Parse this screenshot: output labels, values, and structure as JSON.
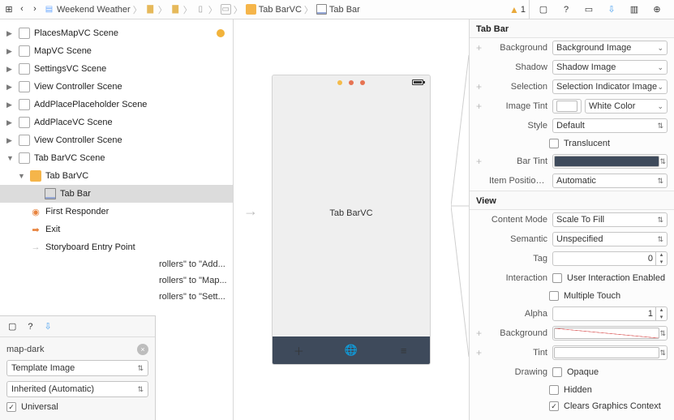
{
  "breadcrumb": {
    "project": "Weekend Weather",
    "tabvc": "Tab BarVC",
    "tabbar": "Tab Bar",
    "warning_count": "1"
  },
  "outline": {
    "scenes": [
      "PlacesMapVC Scene",
      "MapVC Scene",
      "SettingsVC Scene",
      "View Controller Scene",
      "AddPlacePlaceholder Scene",
      "AddPlaceVC Scene",
      "View Controller Scene",
      "Tab BarVC Scene"
    ],
    "tabvc_item": "Tab BarVC",
    "tabbar_item": "Tab Bar",
    "first_responder": "First Responder",
    "exit": "Exit",
    "entry": "Storyboard Entry Point",
    "refs": [
      "rollers\" to \"Add...",
      "rollers\" to \"Map...",
      "rollers\" to \"Sett..."
    ]
  },
  "library": {
    "name": "map-dark",
    "render_as": "Template Image",
    "scale": "Inherited (Automatic)",
    "universal": "Universal"
  },
  "canvas": {
    "title": "Tab BarVC"
  },
  "inspector": {
    "tabbar_section": "Tab Bar",
    "background_label": "Background",
    "background_ph": "Background Image",
    "shadow_label": "Shadow",
    "shadow_ph": "Shadow Image",
    "selection_label": "Selection",
    "selection_ph": "Selection Indicator Image",
    "image_tint_label": "Image Tint",
    "image_tint_val": "White Color",
    "style_label": "Style",
    "style_val": "Default",
    "translucent": "Translucent",
    "bar_tint_label": "Bar Tint",
    "item_pos_label": "Item Positioni...",
    "item_pos_val": "Automatic",
    "view_section": "View",
    "content_mode_label": "Content Mode",
    "content_mode_val": "Scale To Fill",
    "semantic_label": "Semantic",
    "semantic_val": "Unspecified",
    "tag_label": "Tag",
    "tag_val": "0",
    "interaction_label": "Interaction",
    "uie": "User Interaction Enabled",
    "mt": "Multiple Touch",
    "alpha_label": "Alpha",
    "alpha_val": "1",
    "bg_label": "Background",
    "tint_label": "Tint",
    "drawing_label": "Drawing",
    "opaque": "Opaque",
    "hidden": "Hidden",
    "clears": "Clears Graphics Context"
  }
}
